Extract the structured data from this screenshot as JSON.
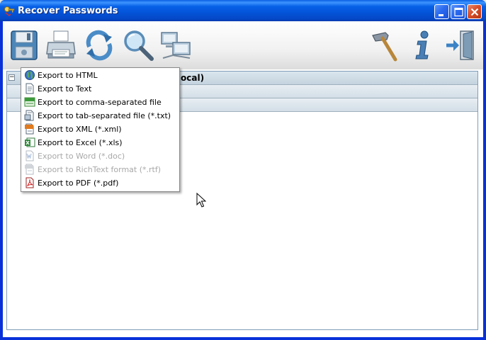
{
  "window": {
    "title": "Recover Passwords",
    "minimize_icon": "minimize-icon",
    "maximize_icon": "maximize-icon",
    "close_icon": "close-icon"
  },
  "toolbar": {
    "left_tools": [
      "floppy-save-icon",
      "printer-icon",
      "refresh-icon",
      "magnifier-icon",
      "network-computers-icon"
    ],
    "right_tools": [
      "hammer-icon",
      "info-icon",
      "exit-door-icon"
    ]
  },
  "tree": {
    "rows": [
      {
        "expander": "−",
        "text": "ocal)"
      },
      {
        "text": ""
      },
      {
        "text": ""
      }
    ]
  },
  "export_menu": {
    "items": [
      {
        "label": "Export to HTML",
        "icon": "globe-icon",
        "enabled": true
      },
      {
        "label": "Export to Text",
        "icon": "text-file-icon",
        "enabled": true
      },
      {
        "label": "Export to comma-separated file",
        "icon": "csv-icon",
        "enabled": true
      },
      {
        "label": "Export to tab-separated file (*.txt)",
        "icon": "tsv-file-icon",
        "enabled": true
      },
      {
        "label": "Export to XML (*.xml)",
        "icon": "xml-icon",
        "enabled": true
      },
      {
        "label": "Export to Excel (*.xls)",
        "icon": "excel-icon",
        "enabled": true
      },
      {
        "label": "Export to Word (*.doc)",
        "icon": "word-icon",
        "enabled": false
      },
      {
        "label": "Export to RichText format (*.rtf)",
        "icon": "rtf-icon",
        "enabled": false
      },
      {
        "label": "Export to PDF (*.pdf)",
        "icon": "pdf-icon",
        "enabled": true
      }
    ]
  },
  "colors": {
    "titlebar": "#0453d8",
    "menu_disabled_text": "#a8a8a8",
    "tree_header": "#c4d3df"
  }
}
